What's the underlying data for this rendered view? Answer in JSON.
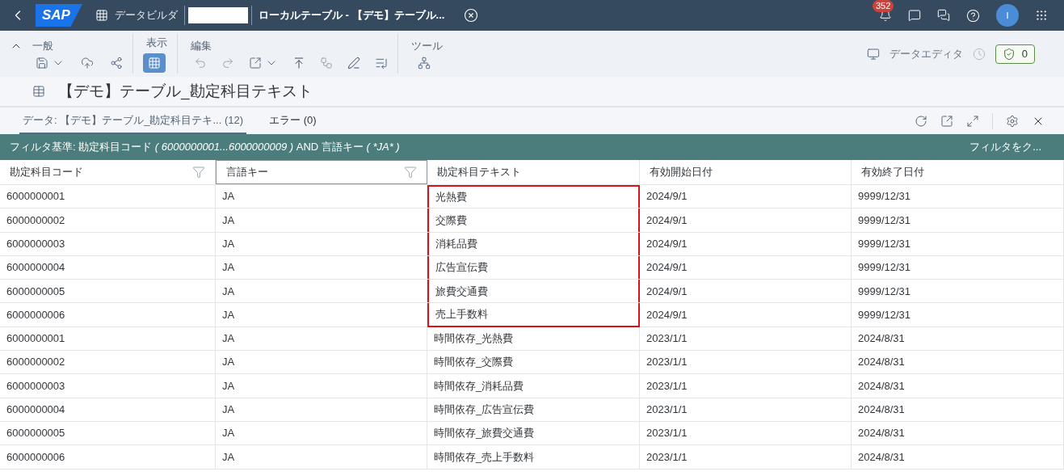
{
  "shell": {
    "logo": "SAP",
    "app": "データビルダ",
    "title": "ローカルテーブル - 【デモ】テーブル...",
    "notifications": "352",
    "avatar": "I"
  },
  "toolbar": {
    "groups": [
      {
        "label": "一般",
        "kind": "general"
      },
      {
        "label": "表示",
        "kind": "view",
        "selected": true
      },
      {
        "label": "編集",
        "kind": "edit"
      },
      {
        "label": "ツール",
        "kind": "tools"
      }
    ],
    "editor_label": "データエディタ",
    "validation_count": "0"
  },
  "heading": "【デモ】テーブル_勘定科目テキスト",
  "tabs": [
    {
      "label": "データ: 【デモ】テーブル_勘定科目テキ... (12)",
      "selected": true
    },
    {
      "label": "エラー (0)",
      "selected": false
    }
  ],
  "filter": {
    "parts": [
      {
        "text": "フィルタ基準: 勘定科目コード ",
        "italic": false
      },
      {
        "text": "( 6000000001...6000000009 )",
        "italic": true
      },
      {
        "text": " AND 言語キー ",
        "italic": false
      },
      {
        "text": "( *JA* )",
        "italic": true
      }
    ],
    "clear": "フィルタをク..."
  },
  "table": {
    "columns": [
      {
        "label": "勘定科目コード",
        "filter": true,
        "focused": false
      },
      {
        "label": "言語キー",
        "filter": true,
        "focused": true
      },
      {
        "label": "勘定科目テキスト",
        "filter": false,
        "focused": false
      },
      {
        "label": "有効開始日付",
        "filter": false,
        "focused": false
      },
      {
        "label": "有効終了日付",
        "filter": false,
        "focused": false
      }
    ],
    "rows": [
      {
        "cells": [
          "6000000001",
          "JA",
          "光熱費",
          "2024/9/1",
          "9999/12/31"
        ],
        "highlighted": true
      },
      {
        "cells": [
          "6000000002",
          "JA",
          "交際費",
          "2024/9/1",
          "9999/12/31"
        ],
        "highlighted": true
      },
      {
        "cells": [
          "6000000003",
          "JA",
          "消耗品費",
          "2024/9/1",
          "9999/12/31"
        ],
        "highlighted": true
      },
      {
        "cells": [
          "6000000004",
          "JA",
          "広告宣伝費",
          "2024/9/1",
          "9999/12/31"
        ],
        "highlighted": true
      },
      {
        "cells": [
          "6000000005",
          "JA",
          "旅費交通費",
          "2024/9/1",
          "9999/12/31"
        ],
        "highlighted": true
      },
      {
        "cells": [
          "6000000006",
          "JA",
          "売上手数料",
          "2024/9/1",
          "9999/12/31"
        ],
        "highlighted": true
      },
      {
        "cells": [
          "6000000001",
          "JA",
          "時間依存_光熱費",
          "2023/1/1",
          "2024/8/31"
        ],
        "highlighted": false
      },
      {
        "cells": [
          "6000000002",
          "JA",
          "時間依存_交際費",
          "2023/1/1",
          "2024/8/31"
        ],
        "highlighted": false
      },
      {
        "cells": [
          "6000000003",
          "JA",
          "時間依存_消耗品費",
          "2023/1/1",
          "2024/8/31"
        ],
        "highlighted": false
      },
      {
        "cells": [
          "6000000004",
          "JA",
          "時間依存_広告宣伝費",
          "2023/1/1",
          "2024/8/31"
        ],
        "highlighted": false
      },
      {
        "cells": [
          "6000000005",
          "JA",
          "時間依存_旅費交通費",
          "2023/1/1",
          "2024/8/31"
        ],
        "highlighted": false
      },
      {
        "cells": [
          "6000000006",
          "JA",
          "時間依存_売上手数料",
          "2023/1/1",
          "2024/8/31"
        ],
        "highlighted": false
      }
    ]
  }
}
